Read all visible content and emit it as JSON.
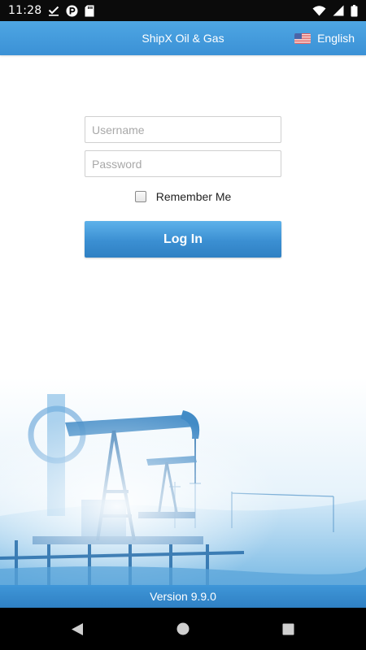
{
  "status_bar": {
    "time": "11:28",
    "left_icons": [
      "download-done-icon",
      "circle-p-icon",
      "sd-card-icon"
    ],
    "right_icons": [
      "wifi-icon",
      "signal-icon",
      "battery-icon"
    ]
  },
  "header": {
    "title": "ShipX Oil & Gas",
    "language_label": "English",
    "flag": "us-flag-icon"
  },
  "form": {
    "username_placeholder": "Username",
    "username_value": "",
    "password_placeholder": "Password",
    "password_value": "",
    "remember_label": "Remember Me",
    "remember_checked": false,
    "login_label": "Log In"
  },
  "footer": {
    "version": "Version 9.9.0"
  },
  "colors": {
    "accent": "#3b91d6",
    "accent_light": "#5eb2ea",
    "status_bar": "#0b0b0b",
    "nav_bar": "#000000"
  },
  "nav_bar": {
    "buttons": [
      "back-icon",
      "home-icon",
      "recents-icon"
    ]
  }
}
